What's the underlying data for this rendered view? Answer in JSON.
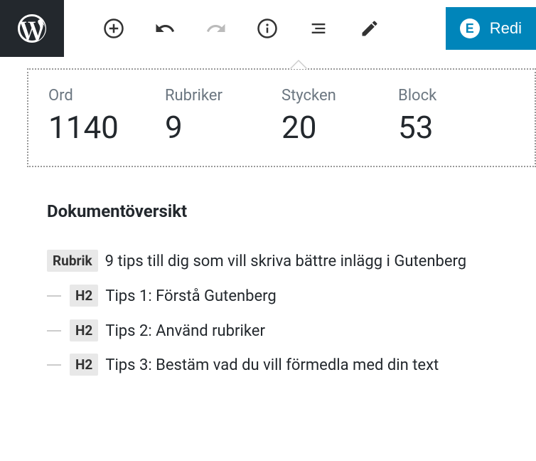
{
  "toolbar": {
    "edit_label": "Redi",
    "e_badge": "E"
  },
  "stats": {
    "words": {
      "label": "Ord",
      "value": "1140"
    },
    "headings": {
      "label": "Rubriker",
      "value": "9"
    },
    "paragraphs": {
      "label": "Stycken",
      "value": "20"
    },
    "blocks": {
      "label": "Block",
      "value": "53"
    }
  },
  "outline": {
    "title": "Dokumentöversikt",
    "items": [
      {
        "badge": "Rubrik",
        "text": "9 tips till dig som vill skriva bättre inlägg i Gutenberg",
        "indent": false
      },
      {
        "badge": "H2",
        "text": "Tips 1: Förstå Gutenberg",
        "indent": true
      },
      {
        "badge": "H2",
        "text": "Tips 2: Använd rubriker",
        "indent": true
      },
      {
        "badge": "H2",
        "text": "Tips 3: Bestäm vad du vill förmedla med din text",
        "indent": true
      }
    ]
  }
}
